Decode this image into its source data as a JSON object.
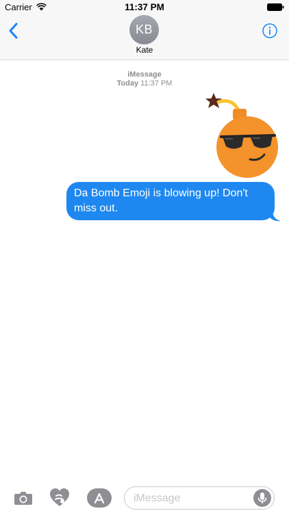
{
  "status_bar": {
    "carrier": "Carrier",
    "time": "11:37 PM"
  },
  "header": {
    "back_icon": "chevron-left-icon",
    "contact_initials": "KB",
    "contact_name": "Kate",
    "info_icon": "info-icon",
    "accent_color": "#1a82fb"
  },
  "conversation": {
    "service": "iMessage",
    "timestamp_day": "Today",
    "timestamp_time": "11:37 PM",
    "sticker_icon": "bomb-emoji-sunglasses-sticker",
    "messages": [
      {
        "sender": "me",
        "text": "Da Bomb Emoji is blowing up! Don't miss out.",
        "bubble_color": "#1e88f0"
      }
    ]
  },
  "input_bar": {
    "placeholder": "iMessage",
    "value": "",
    "buttons": [
      "camera-icon",
      "digital-touch-icon",
      "app-store-icon",
      "microphone-icon"
    ]
  }
}
